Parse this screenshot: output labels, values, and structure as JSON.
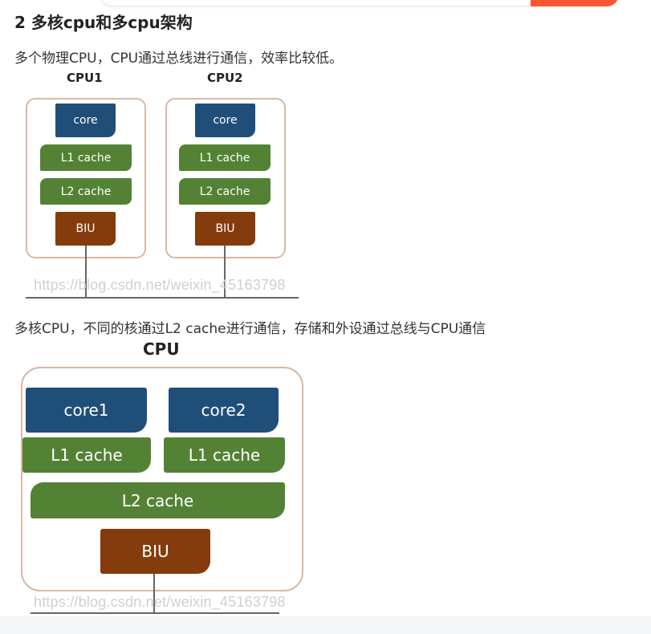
{
  "header": {
    "title": "2 多核cpu和多cpu架构"
  },
  "paragraphs": {
    "multi_cpu": "多个物理CPU，CPU通过总线进行通信，效率比较低。",
    "multi_core": "多核CPU，不同的核通过L2 cache进行通信，存储和外设通过总线与CPU通信"
  },
  "figure1": {
    "cpus": [
      {
        "label": "CPU1",
        "core": "core",
        "l1": "L1 cache",
        "l2": "L2 cache",
        "biu": "BIU"
      },
      {
        "label": "CPU2",
        "core": "core",
        "l1": "L1 cache",
        "l2": "L2 cache",
        "biu": "BIU"
      }
    ],
    "watermark": "https://blog.csdn.net/weixin_45163798"
  },
  "figure2": {
    "label": "CPU",
    "core1": "core1",
    "core2": "core2",
    "l1_left": "L1 cache",
    "l1_right": "L1 cache",
    "l2": "L2 cache",
    "biu": "BIU",
    "watermark": "https://blog.csdn.net/weixin_45163798"
  },
  "colors": {
    "core": "#1f4e79",
    "cache": "#548235",
    "biu": "#843c0c",
    "accent": "#fc5531"
  }
}
